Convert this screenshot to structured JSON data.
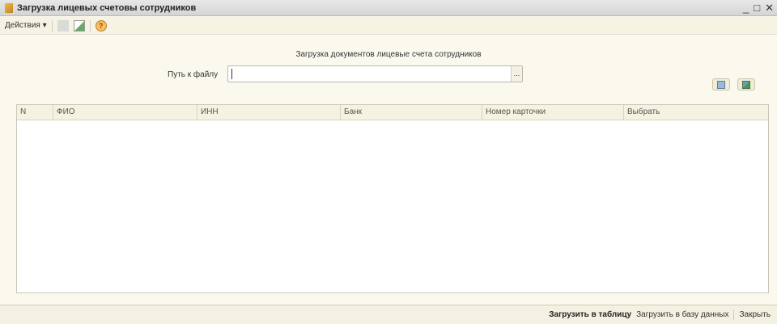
{
  "window": {
    "title": "Загрузка  лицевых счетовы сотрудников",
    "minimize": "_",
    "maximize": "□",
    "close": "✕"
  },
  "toolbar": {
    "actions_label": "Действия ▾"
  },
  "form": {
    "heading": "Загрузка  документов  лицевые счета сотрудников",
    "file_path_label": "Путь к файлу",
    "file_path_value": "",
    "browse_label": "..."
  },
  "table": {
    "columns": [
      "N",
      "ФИО",
      "ИНН",
      "Банк",
      "Номер карточки",
      "Выбрать"
    ],
    "rows": []
  },
  "footer": {
    "load_table": "Загрузить в таблицу",
    "load_db": "Загрузить в базу данных",
    "close": "Закрыть"
  }
}
